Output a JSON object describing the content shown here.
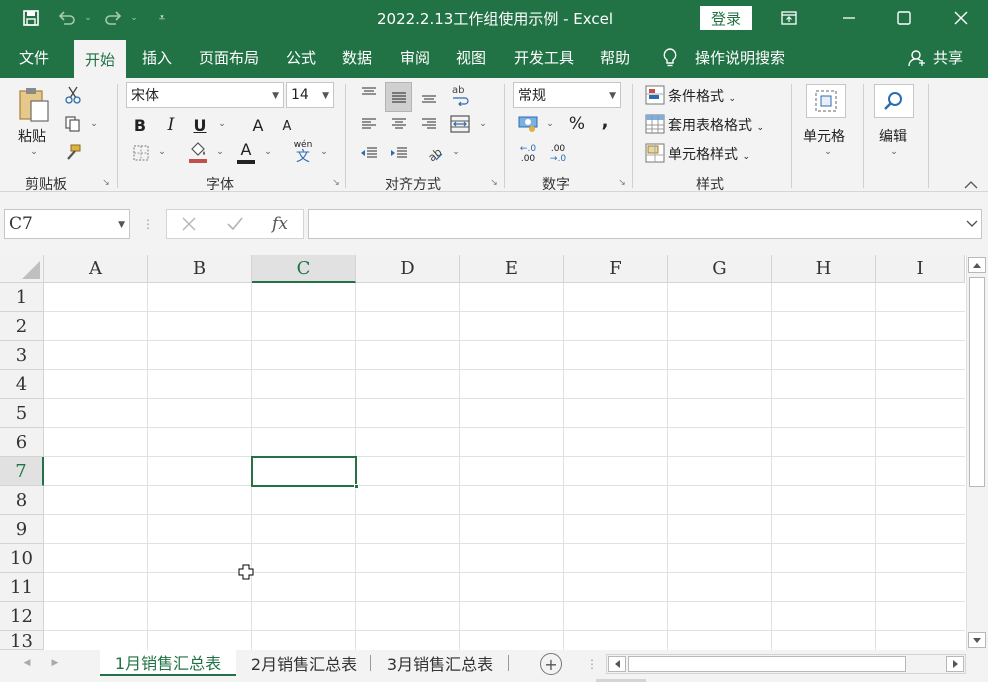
{
  "title_bar": {
    "document_title": "2022.2.13工作组使用示例  -  Excel",
    "login_label": "登录",
    "icons": [
      "save-icon",
      "undo-icon",
      "redo-icon",
      "customize-qat-icon",
      "ribbon-display-icon",
      "minimize-icon",
      "maximize-icon",
      "close-icon"
    ]
  },
  "ribbon_tabs": {
    "items": [
      "文件",
      "开始",
      "插入",
      "页面布局",
      "公式",
      "数据",
      "审阅",
      "视图",
      "开发工具",
      "帮助"
    ],
    "active": "开始",
    "tell_me": "操作说明搜索",
    "share": "共享"
  },
  "clipboard": {
    "paste": "粘贴",
    "group_label": "剪贴板"
  },
  "font": {
    "font_name": "宋体",
    "font_size": "14",
    "bold": "B",
    "italic": "I",
    "underline": "U",
    "grow": "A",
    "shrink": "A",
    "font_color": "A",
    "phonetic_top": "wén",
    "phonetic_char": "文",
    "group_label": "字体"
  },
  "alignment": {
    "wrap_text": "ab",
    "group_label": "对齐方式"
  },
  "number": {
    "format": "常规",
    "percent": "%",
    "comma": ",",
    "inc_decimal": ".00",
    "dec_decimal": ".00",
    "group_label": "数字"
  },
  "styles": {
    "conditional": "条件格式",
    "table_format": "套用表格格式",
    "cell_styles": "单元格样式",
    "group_label": "样式"
  },
  "cells": {
    "label": "单元格"
  },
  "editing": {
    "label": "编辑"
  },
  "formula_bar": {
    "name_box": "C7",
    "fx": "fx",
    "formula": ""
  },
  "grid": {
    "columns": [
      "A",
      "B",
      "C",
      "D",
      "E",
      "F",
      "G",
      "H",
      "I"
    ],
    "rows": [
      "1",
      "2",
      "3",
      "4",
      "5",
      "6",
      "7",
      "8",
      "9",
      "10",
      "11",
      "12",
      "13"
    ],
    "active_cell": "C7",
    "active_column": "C",
    "active_row": "7"
  },
  "sheets": {
    "tabs": [
      "1月销售汇总表",
      "2月销售汇总表",
      "3月销售汇总表"
    ],
    "active": "1月销售汇总表",
    "add_label": "+"
  },
  "colors": {
    "accent": "#217346",
    "ribbon_bg": "#f3f3f3",
    "header_bg": "#f2f2f2",
    "gridline": "#e1e1e1"
  }
}
